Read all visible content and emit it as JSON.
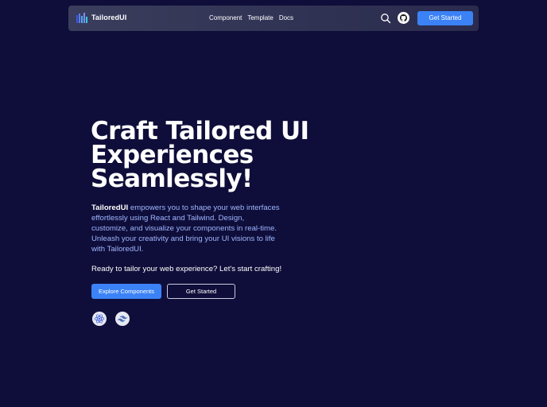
{
  "navbar": {
    "brand": "TailoredUI",
    "links": [
      "Component",
      "Template",
      "Docs"
    ],
    "cta_label": "Get Started",
    "icons": [
      "logo-icon",
      "search-icon",
      "github-icon"
    ]
  },
  "hero": {
    "title_lines": [
      "Craft Tailored UI",
      "Experiences",
      "Seamlessly!"
    ],
    "description_brand": "TailoredUI",
    "description_rest": " empowers you to shape your web interfaces effortlessly using React and Tailwind. Design, customize, and visualize your components in real-time. Unleash your creativity and bring your UI visions to life with TailoredUI.",
    "subtext": "Ready to tailor your web experience? Let's start crafting!",
    "primary_button": "Explore Components",
    "secondary_button": "Get Started",
    "tech_icons": [
      "react-icon",
      "tailwind-icon"
    ]
  },
  "colors": {
    "background": "#0f0e3a",
    "accent": "#3b82f6",
    "description_text": "#9fb6ff"
  }
}
